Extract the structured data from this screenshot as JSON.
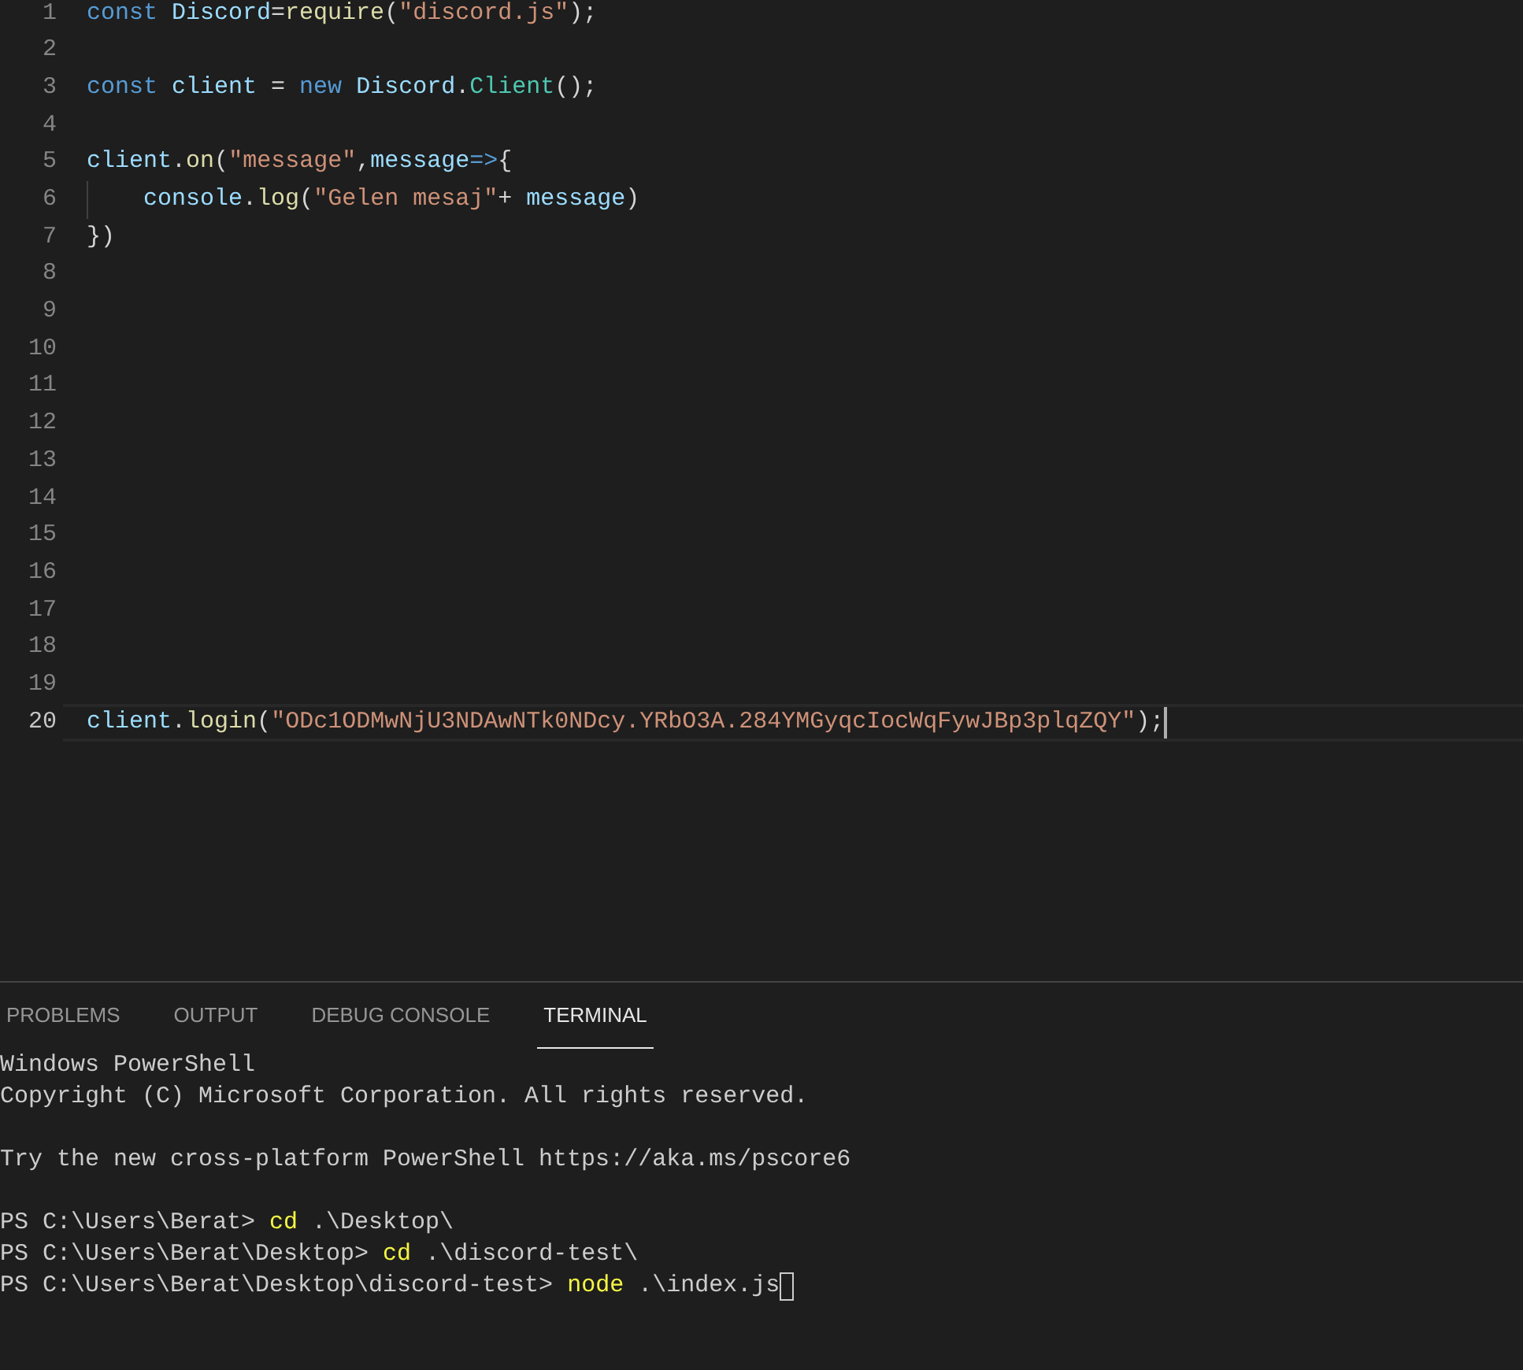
{
  "editor": {
    "lines": [
      {
        "number": "1",
        "selected": false,
        "tokens": [
          {
            "kind": "keyword",
            "text": "const "
          },
          {
            "kind": "variable",
            "text": "Discord"
          },
          {
            "kind": "plain",
            "text": "="
          },
          {
            "kind": "function",
            "text": "require"
          },
          {
            "kind": "plain",
            "text": "("
          },
          {
            "kind": "string",
            "text": "\"discord.js\""
          },
          {
            "kind": "plain",
            "text": ");"
          }
        ]
      },
      {
        "number": "2",
        "selected": false
      },
      {
        "number": "3",
        "selected": false,
        "tokens": [
          {
            "kind": "keyword",
            "text": "const "
          },
          {
            "kind": "variable",
            "text": "client"
          },
          {
            "kind": "plain",
            "text": " = "
          },
          {
            "kind": "keyword",
            "text": "new "
          },
          {
            "kind": "variable",
            "text": "Discord"
          },
          {
            "kind": "plain",
            "text": "."
          },
          {
            "kind": "class",
            "text": "Client"
          },
          {
            "kind": "plain",
            "text": "();"
          }
        ]
      },
      {
        "number": "4",
        "selected": false
      },
      {
        "number": "5",
        "selected": false,
        "tokens": [
          {
            "kind": "variable",
            "text": "client"
          },
          {
            "kind": "plain",
            "text": "."
          },
          {
            "kind": "function",
            "text": "on"
          },
          {
            "kind": "plain",
            "text": "("
          },
          {
            "kind": "string",
            "text": "\"message\""
          },
          {
            "kind": "plain",
            "text": ","
          },
          {
            "kind": "variable",
            "text": "message"
          },
          {
            "kind": "keyword",
            "text": "=>"
          },
          {
            "kind": "plain",
            "text": "{"
          }
        ]
      },
      {
        "number": "6",
        "selected": false,
        "indented": true,
        "tokens": [
          {
            "kind": "variable",
            "text": "console"
          },
          {
            "kind": "plain",
            "text": "."
          },
          {
            "kind": "function",
            "text": "log"
          },
          {
            "kind": "plain",
            "text": "("
          },
          {
            "kind": "string",
            "text": "\"Gelen mesaj\""
          },
          {
            "kind": "plain",
            "text": "+ "
          },
          {
            "kind": "variable",
            "text": "message"
          },
          {
            "kind": "plain",
            "text": ")"
          }
        ]
      },
      {
        "number": "7",
        "selected": false,
        "tokens": [
          {
            "kind": "plain",
            "text": "})"
          }
        ]
      },
      {
        "number": "8",
        "selected": false
      },
      {
        "number": "9",
        "selected": false
      },
      {
        "number": "10",
        "selected": false
      },
      {
        "number": "11",
        "selected": false
      },
      {
        "number": "12",
        "selected": false
      },
      {
        "number": "13",
        "selected": false
      },
      {
        "number": "14",
        "selected": false
      },
      {
        "number": "15",
        "selected": false
      },
      {
        "number": "16",
        "selected": false
      },
      {
        "number": "17",
        "selected": false
      },
      {
        "number": "18",
        "selected": false
      },
      {
        "number": "19",
        "selected": false
      },
      {
        "number": "20",
        "selected": true,
        "tokens": [
          {
            "kind": "variable",
            "text": "client"
          },
          {
            "kind": "plain",
            "text": "."
          },
          {
            "kind": "function",
            "text": "login"
          },
          {
            "kind": "plain",
            "text": "("
          },
          {
            "kind": "string",
            "text": "\"ODc1ODMwNjU3NDAwNTk0NDcy.YRbO3A.284YMGyqcIocWqFywJBp3plqZQY\""
          },
          {
            "kind": "plain",
            "text": ");"
          }
        ]
      }
    ]
  },
  "panel": {
    "tabs": [
      {
        "label": "PROBLEMS",
        "selected": false
      },
      {
        "label": "OUTPUT",
        "selected": false
      },
      {
        "label": "DEBUG CONSOLE",
        "selected": false
      },
      {
        "label": "TERMINAL",
        "selected": true
      }
    ],
    "terminal": [
      {
        "segments": [
          {
            "kind": "text",
            "text": "Windows PowerShell"
          }
        ]
      },
      {
        "segments": [
          {
            "kind": "text",
            "text": "Copyright (C) Microsoft Corporation. All rights reserved."
          }
        ]
      },
      {
        "gap_before": true,
        "segments": [
          {
            "kind": "text",
            "text": "Try the new cross-platform PowerShell https://aka.ms/pscore6"
          }
        ]
      },
      {
        "gap_before": true,
        "segments": [
          {
            "kind": "text",
            "text": "PS C:\\Users\\Berat> "
          },
          {
            "kind": "command",
            "text": "cd"
          },
          {
            "kind": "text",
            "text": " .\\Desktop\\"
          }
        ]
      },
      {
        "segments": [
          {
            "kind": "text",
            "text": "PS C:\\Users\\Berat\\Desktop> "
          },
          {
            "kind": "command",
            "text": "cd"
          },
          {
            "kind": "text",
            "text": " .\\discord-test\\"
          }
        ]
      },
      {
        "segments": [
          {
            "kind": "text",
            "text": "PS C:\\Users\\Berat\\Desktop\\discord-test> "
          },
          {
            "kind": "command",
            "text": "node"
          },
          {
            "kind": "text",
            "text": " .\\index.js"
          }
        ]
      }
    ]
  }
}
